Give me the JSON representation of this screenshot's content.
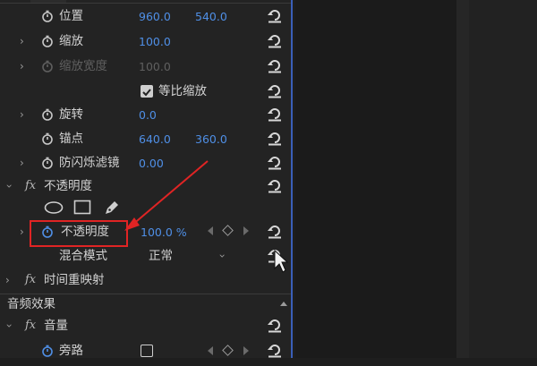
{
  "properties": {
    "position": {
      "label": "位置",
      "x": "960.0",
      "y": "540.0"
    },
    "scale": {
      "label": "缩放",
      "value": "100.0"
    },
    "scale_width": {
      "label": "缩放宽度",
      "value": "100.0"
    },
    "uniform_scale": {
      "label": "等比缩放",
      "checked": true
    },
    "rotation": {
      "label": "旋转",
      "value": "0.0"
    },
    "anchor": {
      "label": "锚点",
      "x": "640.0",
      "y": "360.0"
    },
    "anti_flicker": {
      "label": "防闪烁滤镜",
      "value": "0.00"
    }
  },
  "opacity_section": {
    "fx": "fx",
    "title": "不透明度",
    "opacity_label": "不透明度",
    "opacity_value": "100.0 %",
    "blend_label": "混合模式",
    "blend_value": "正常"
  },
  "time_remap": {
    "fx": "fx",
    "title": "时间重映射"
  },
  "audio_effects": {
    "header": "音频效果",
    "fx": "fx",
    "volume": "音量",
    "bypass": "旁路"
  },
  "colors": {
    "value_blue": "#4f8fe6",
    "highlight_red": "#e02424",
    "panel_edge": "#3a5fb8"
  }
}
